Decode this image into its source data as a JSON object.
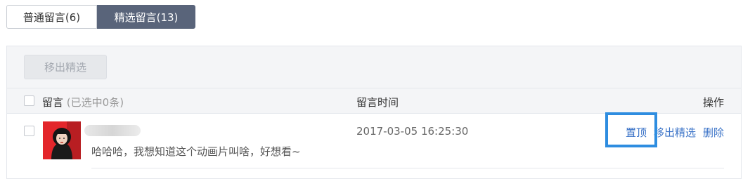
{
  "tabs": {
    "normal": "普通留言(6)",
    "selected": "精选留言(13)"
  },
  "toolbar": {
    "remove_label": "移出精选"
  },
  "table": {
    "header_label": "留言",
    "header_selected": "(已选中0条)",
    "header_time": "留言时间",
    "header_ops": "操作"
  },
  "rows": [
    {
      "comment": "哈哈哈，我想知道这个动画片叫啥，好想看~",
      "time": "2017-03-05 16:25:30",
      "actions": {
        "pin": "置顶",
        "remove": "移出精选",
        "delete": "删除"
      }
    }
  ],
  "colors": {
    "active_tab": "#59647a",
    "link": "#3c74c8",
    "highlight": "#2e8de0"
  }
}
